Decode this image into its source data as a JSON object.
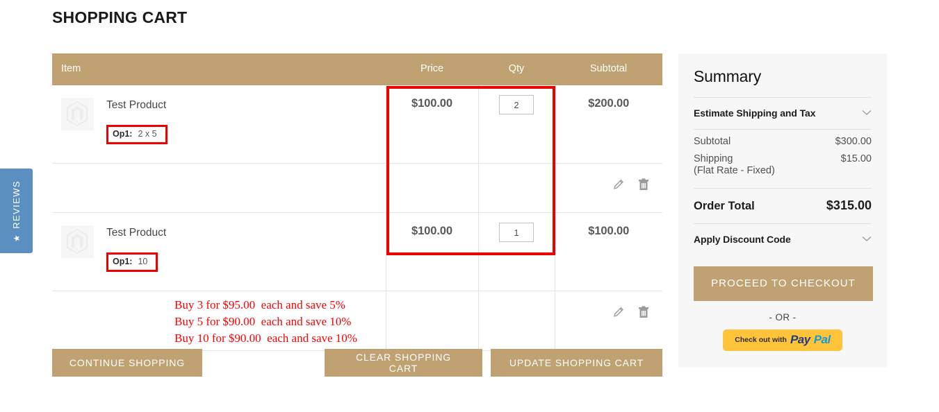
{
  "page": {
    "title": "SHOPPING CART"
  },
  "reviews_tab": {
    "label": "REVIEWS",
    "star": "★",
    "color": "#5b8fc0"
  },
  "cart_table": {
    "accent_color": "#c0a172",
    "columns": [
      "Item",
      "Price",
      "Qty",
      "Subtotal"
    ],
    "rows": [
      {
        "name": "Test Product",
        "option_label": "Op1:",
        "option_value": "2 x 5",
        "price": "$100.00",
        "qty": "2",
        "subtotal": "$200.00",
        "edit_icon": "pencil-icon",
        "delete_icon": "trash-icon",
        "tier_prices": []
      },
      {
        "name": "Test Product",
        "option_label": "Op1:",
        "option_value": "10",
        "price": "$100.00",
        "qty": "1",
        "subtotal": "$100.00",
        "edit_icon": "pencil-icon",
        "delete_icon": "trash-icon",
        "tier_prices": [
          "Buy 3 for $95.00  each and save 5%",
          "Buy 5 for $90.00  each and save 10%",
          "Buy 10 for $90.00  each and save 10%"
        ]
      }
    ]
  },
  "annotations": {
    "box_color": "#ee0000",
    "highlights": [
      "price-qty-columns",
      "row1-option",
      "row2-option"
    ]
  },
  "actions": {
    "continue_shopping": "CONTINUE SHOPPING",
    "clear_cart": "CLEAR SHOPPING CART",
    "update_cart": "UPDATE SHOPPING CART"
  },
  "summary": {
    "title": "Summary",
    "estimate_label": "Estimate Shipping and Tax",
    "estimate_chevron": "chevron-down-icon",
    "subtotal_label": "Subtotal",
    "subtotal_value": "$300.00",
    "shipping_label": "Shipping",
    "shipping_value": "$15.00",
    "shipping_method": "(Flat Rate - Fixed)",
    "order_total_label": "Order Total",
    "order_total_value": "$315.00",
    "discount_label": "Apply Discount Code",
    "discount_chevron": "chevron-down-icon",
    "checkout_button": "PROCEED TO CHECKOUT",
    "or_separator": "- OR -",
    "paypal_prefix": "Check out with",
    "paypal_pay": "Pay",
    "paypal_pal": "Pal"
  }
}
